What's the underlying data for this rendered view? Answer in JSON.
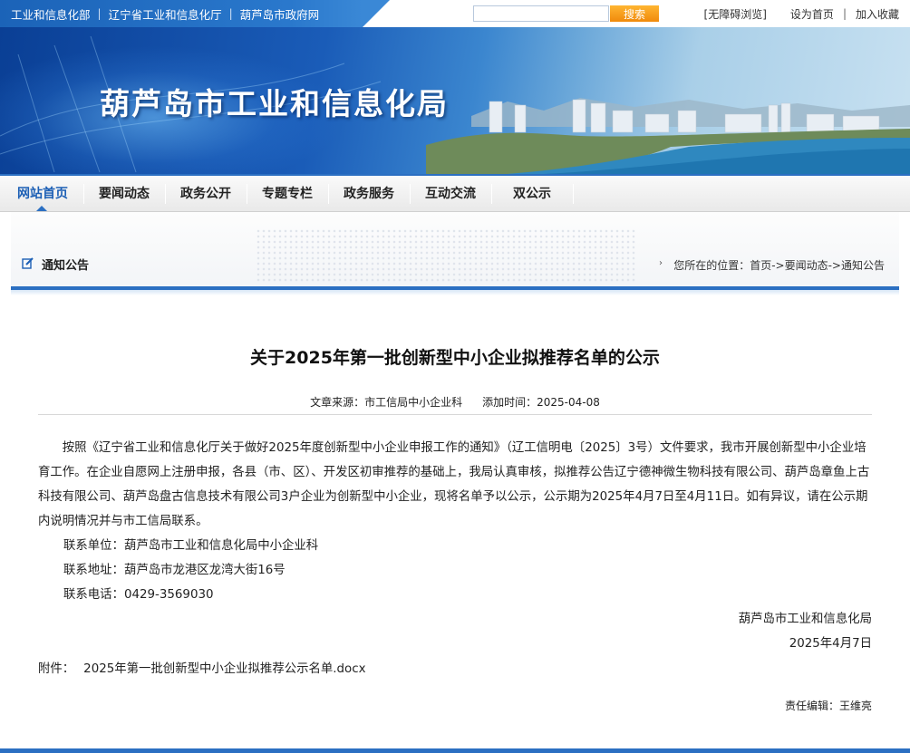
{
  "top_links": [
    "工业和信息化部",
    "辽宁省工业和信息化厅",
    "葫芦岛市政府网"
  ],
  "search": {
    "placeholder": "",
    "button": "搜索"
  },
  "top_right": {
    "accessible": "[无障碍浏览]",
    "set_home": "设为首页",
    "separator": "|",
    "bookmark": "加入收藏"
  },
  "banner": {
    "title": "葫芦岛市工业和信息化局"
  },
  "nav": {
    "items": [
      "网站首页",
      "要闻动态",
      "政务公开",
      "专题专栏",
      "政务服务",
      "互动交流",
      "双公示"
    ],
    "active_index": 0
  },
  "section": {
    "title": "通知公告",
    "breadcrumb": "您所在的位置：首页->要闻动态->通知公告"
  },
  "article": {
    "title": "关于2025年第一批创新型中小企业拟推荐名单的公示",
    "source": "文章来源：市工信局中小企业科",
    "date": "添加时间：2025-04-08",
    "paragraph": "按照《辽宁省工业和信息化厅关于做好2025年度创新型中小企业申报工作的通知》（辽工信明电〔2025〕3号）文件要求，我市开展创新型中小企业培育工作。在企业自愿网上注册申报，各县（市、区）、开发区初审推荐的基础上，我局认真审核，拟推荐公告辽宁德神微生物科技有限公司、葫芦岛章鱼上古科技有限公司、葫芦岛盘古信息技术有限公司3户企业为创新型中小企业，现将名单予以公示，公示期为2025年4月7日至4月11日。如有异议，请在公示期内说明情况并与市工信局联系。",
    "contact_unit": "联系单位：葫芦岛市工业和信息化局中小企业科",
    "contact_address": "联系地址：葫芦岛市龙港区龙湾大街16号",
    "contact_phone": "联系电话：0429-3569030",
    "signature_org": "葫芦岛市工业和信息化局",
    "signature_date": "2025年4月7日",
    "attachment_label": "附件：",
    "attachment_file": "2025年第一批创新型中小企业拟推荐公示名单.docx",
    "editor": "责任编辑：王维亮"
  },
  "colors": {
    "brand_blue": "#2b6fc2",
    "search_orange": "#f08a0c"
  }
}
